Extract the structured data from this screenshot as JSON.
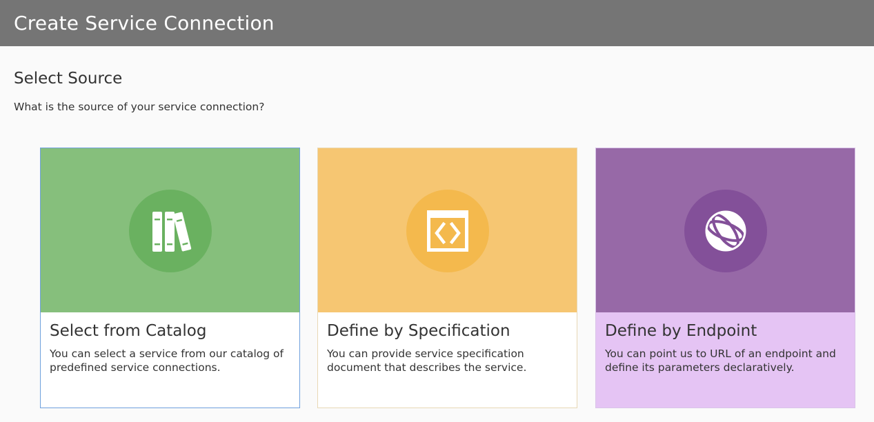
{
  "window": {
    "title": "Create Service Connection"
  },
  "section": {
    "title": "Select Source",
    "subtitle": "What is the source of your service connection?"
  },
  "cards": [
    {
      "title": "Select from Catalog",
      "description": "You can select a service from our catalog of predefined service connections.",
      "icon": "books-icon",
      "color": "#86bf7c",
      "selected": true
    },
    {
      "title": "Define by Specification",
      "description": "You can provide service specification document that describes the service.",
      "icon": "code-document-icon",
      "color": "#f6c672",
      "selected": false
    },
    {
      "title": "Define by Endpoint",
      "description": "You can point us to URL of an endpoint and define its parameters declaratively.",
      "icon": "globe-endpoint-icon",
      "color": "#9769a7",
      "selected": false
    }
  ]
}
